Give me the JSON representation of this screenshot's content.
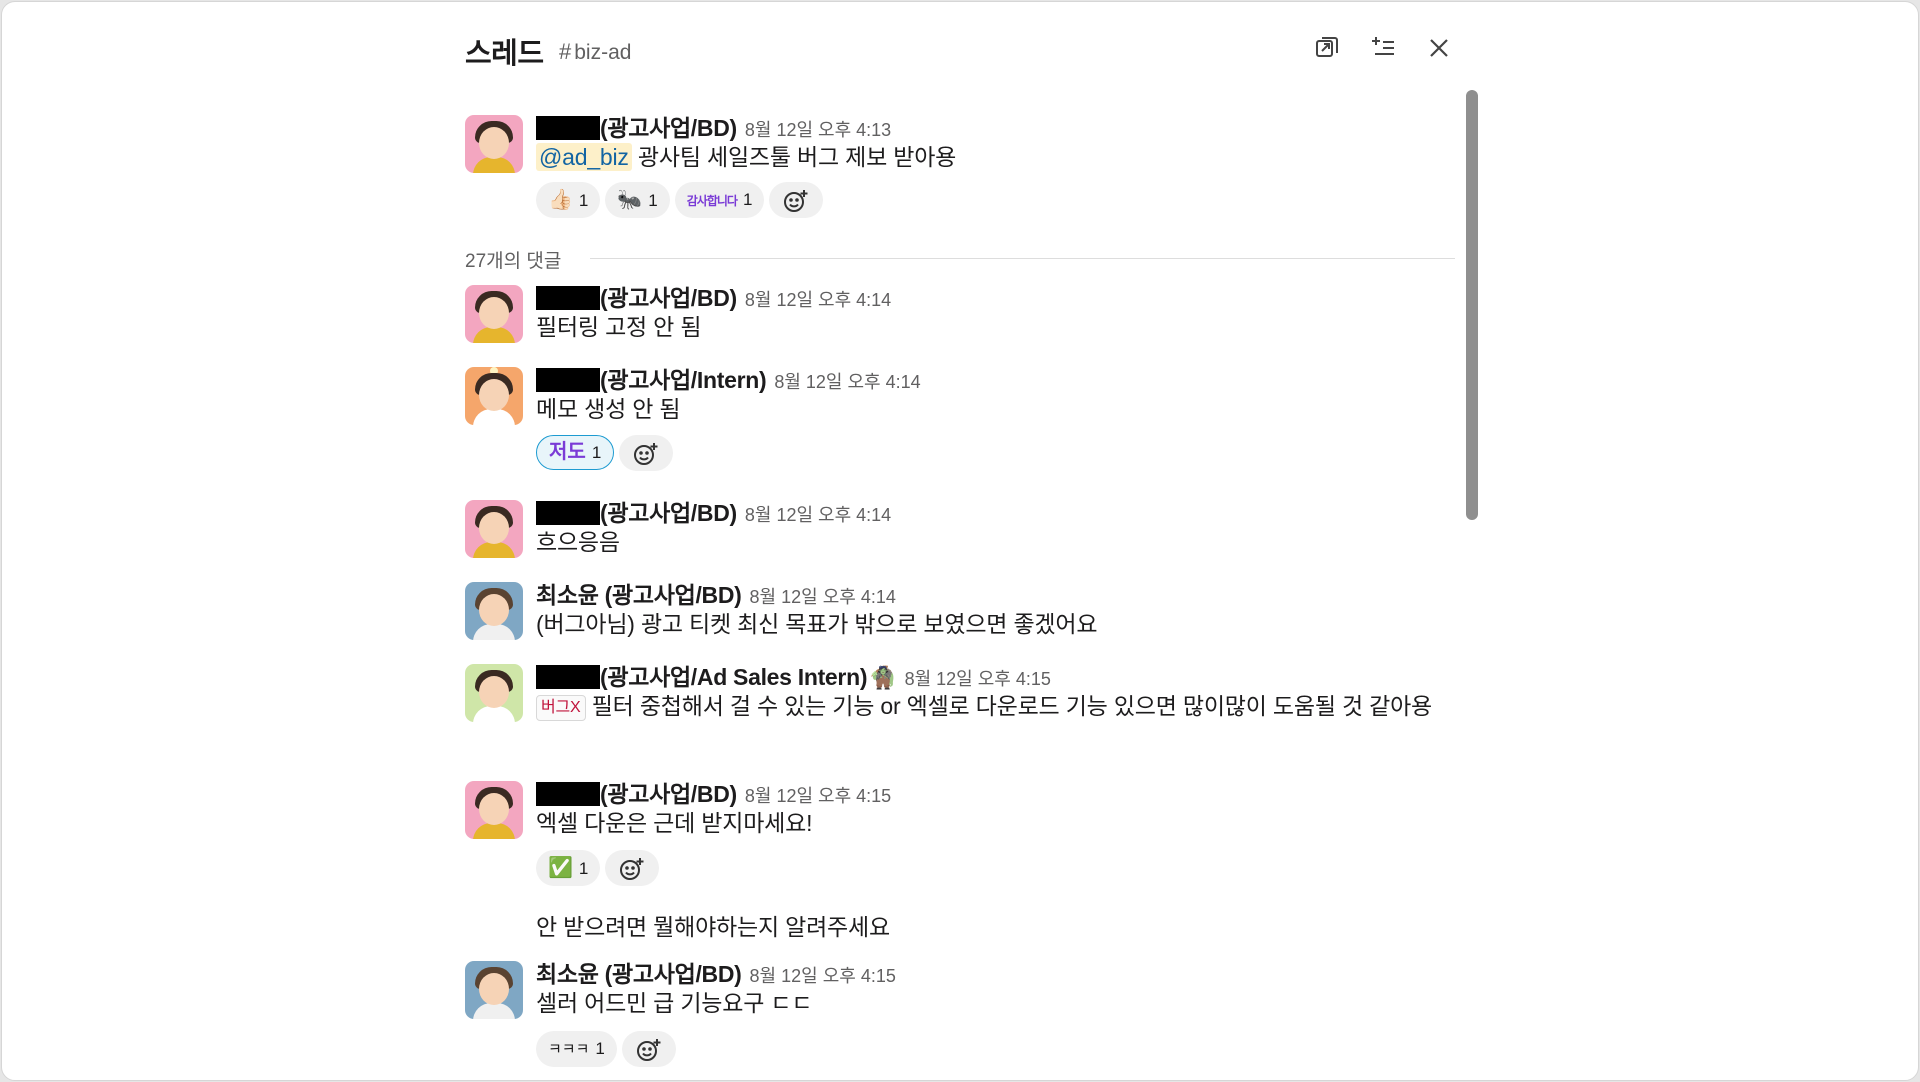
{
  "header": {
    "title": "스레드",
    "channel": "biz-ad"
  },
  "parent": {
    "name": "(광고사업/BD)",
    "time": "8월 12일 오후 4:13",
    "mention": "@ad_biz",
    "text": " 광사팀 세일즈툴 버그 제보 받아용",
    "reactions": [
      {
        "emoji": "👍🏻",
        "count": "1"
      },
      {
        "emoji": "🐜",
        "count": "1"
      },
      {
        "emoji": "감사합니다",
        "count": "1"
      }
    ]
  },
  "reply_count": "27개의 댓글",
  "messages": [
    {
      "name": "(광고사업/BD)",
      "time": "8월 12일 오후 4:14",
      "text": "필터링 고정 안 됨"
    },
    {
      "name": "(광고사업/Intern)",
      "time": "8월 12일 오후 4:14",
      "text": "메모 생성 안 됨",
      "reactions": [
        {
          "emoji": "저도",
          "count": "1"
        }
      ]
    },
    {
      "name": "(광고사업/BD)",
      "time": "8월 12일 오후 4:14",
      "text": "흐으응음"
    },
    {
      "name": "최소윤 (광고사업/BD)",
      "time": "8월 12일 오후 4:14",
      "text": "(버그아님) 광고 티켓 최신 목표가 밖으로 보였으면 좋겠어요"
    },
    {
      "name": "(광고사업/Ad Sales Intern)",
      "status": "🧌",
      "time": "8월 12일 오후 4:15",
      "tag": "버그X",
      "text": " 필터 중첩해서 걸 수 있는 기능 or 엑셀로 다운로드 기능 있으면 많이많이 도움될 것 같아용"
    },
    {
      "name": "(광고사업/BD)",
      "time": "8월 12일 오후 4:15",
      "text": "엑셀 다운은 근데 받지마세요!",
      "reactions": [
        {
          "emoji": "✅",
          "count": "1"
        }
      ],
      "continuation": "안 받으려면 뭘해야하는지 알려주세요"
    },
    {
      "name": "최소윤 (광고사업/BD)",
      "time": "8월 12일 오후 4:15",
      "text": "셀러 어드민 급 기능요구 ㄷㄷ",
      "reactions": [
        {
          "emoji": "ㅋㅋㅋ",
          "count": "1"
        }
      ]
    }
  ]
}
